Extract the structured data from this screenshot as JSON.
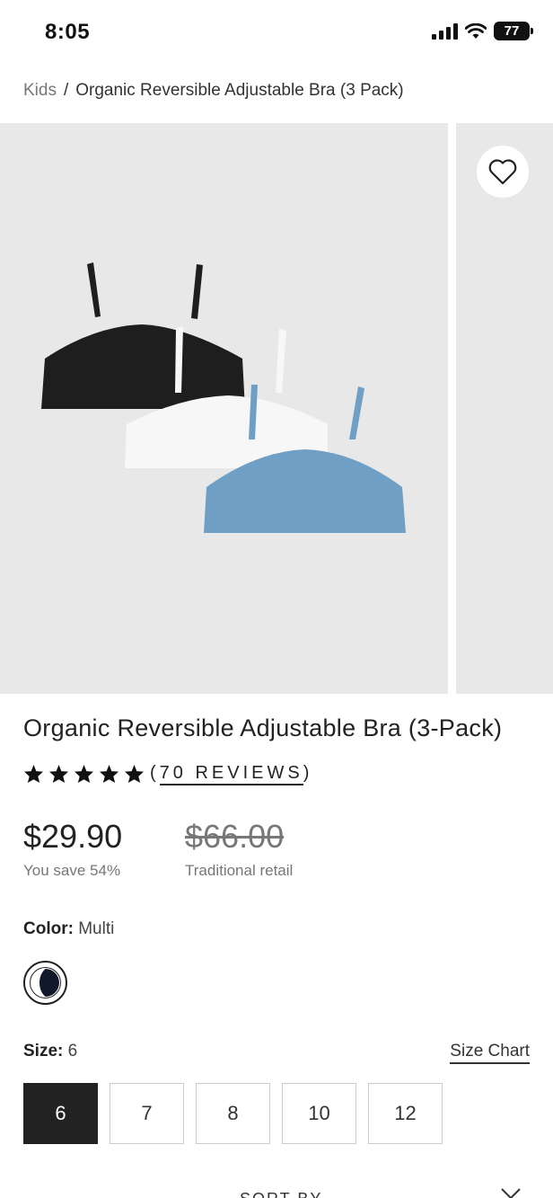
{
  "status": {
    "time": "8:05",
    "battery": "77"
  },
  "breadcrumb": {
    "parent": "Kids",
    "separator": "/",
    "current": "Organic Reversible Adjustable Bra (3 Pack)"
  },
  "product": {
    "title": "Organic Reversible Adjustable Bra (3-Pack)",
    "rating": 5,
    "reviews_open": "(",
    "reviews_label": "70 REVIEWS",
    "reviews_close": ")",
    "price": "$29.90",
    "savings": "You save 54%",
    "retail_price": "$66.00",
    "retail_label": "Traditional retail"
  },
  "color": {
    "label": "Color:",
    "value": "Multi"
  },
  "size": {
    "label": "Size:",
    "value": "6",
    "chart_link": "Size Chart",
    "options": [
      "6",
      "7",
      "8",
      "10",
      "12"
    ],
    "selected": "6"
  },
  "sort": {
    "label": "SORT BY"
  },
  "colors": {
    "black_bra": "#1e1e1e",
    "white_bra": "#f7f7f7",
    "blue_bra": "#6f9fc4",
    "image_bg": "#e8e8e8"
  }
}
